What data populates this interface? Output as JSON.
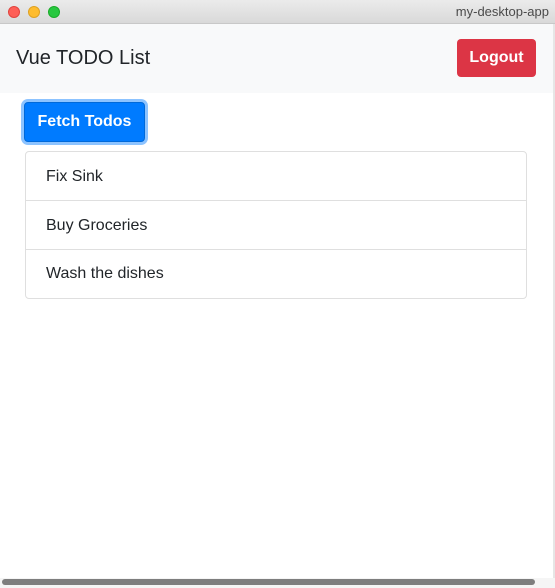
{
  "window": {
    "title": "my-desktop-app"
  },
  "navbar": {
    "brand": "Vue TODO List",
    "logout_label": "Logout"
  },
  "actions": {
    "fetch_label": "Fetch Todos"
  },
  "todos": [
    {
      "text": "Fix Sink"
    },
    {
      "text": "Buy Groceries"
    },
    {
      "text": "Wash the dishes"
    }
  ],
  "colors": {
    "primary": "#007bff",
    "danger": "#dc3545",
    "navbar_bg": "#f8f9fa"
  }
}
